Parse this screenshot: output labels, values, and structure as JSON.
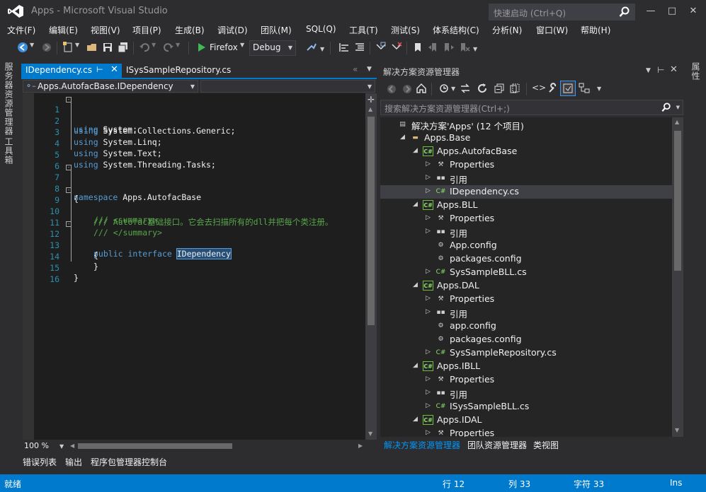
{
  "window": {
    "title": "Apps - Microsoft Visual Studio",
    "quick_launch_placeholder": "快速启动 (Ctrl+Q)",
    "controls": [
      "minimize",
      "maximize",
      "close"
    ]
  },
  "menu": [
    "文件(F)",
    "编辑(E)",
    "视图(V)",
    "项目(P)",
    "生成(B)",
    "调试(D)",
    "团队(M)",
    "SQL(Q)",
    "工具(T)",
    "测试(S)",
    "体系结构(C)",
    "分析(N)",
    "窗口(W)",
    "帮助(H)"
  ],
  "toolbar": {
    "browser": "Firefox",
    "configuration": "Debug"
  },
  "left_side_tabs": [
    "服务器资源管理器",
    "工具箱"
  ],
  "right_side_tabs": [
    "属性"
  ],
  "editor": {
    "tabs": [
      {
        "label": "IDependency.cs",
        "active": true
      },
      {
        "label": "ISysSampleRepository.cs",
        "active": false
      }
    ],
    "nav_left": "Apps.AutofacBase.IDependency",
    "nav_right": "",
    "zoom": "100 %",
    "lines": [
      {
        "n": "1",
        "text": "using System;"
      },
      {
        "n": "2",
        "text": "using System.Collections.Generic;"
      },
      {
        "n": "3",
        "text": "using System.Linq;"
      },
      {
        "n": "4",
        "text": "using System.Text;"
      },
      {
        "n": "5",
        "text": "using System.Threading.Tasks;"
      },
      {
        "n": "6",
        "text": ""
      },
      {
        "n": "7",
        "text": "namespace Apps.AutofacBase"
      },
      {
        "n": "8",
        "text": "{"
      },
      {
        "n": "9",
        "text": "/// <summary>"
      },
      {
        "n": "10",
        "text": "/// Autofac基础接口。它会去扫描所有的dll并把每个类注册。"
      },
      {
        "n": "11",
        "text": "/// </summary>"
      },
      {
        "n": "12",
        "text": "public interface IDependency"
      },
      {
        "n": "13",
        "text": "{"
      },
      {
        "n": "14",
        "text": "}"
      },
      {
        "n": "15",
        "text": "}"
      },
      {
        "n": "16",
        "text": ""
      }
    ]
  },
  "solution_explorer": {
    "title": "解决方案资源管理器",
    "search_placeholder": "搜索解决方案资源管理器(Ctrl+;)",
    "items": [
      {
        "label": "解决方案'Apps' (12 个项目)",
        "icon": "solution-icon",
        "level": 0,
        "twisty": ""
      },
      {
        "label": "Apps.Base",
        "icon": "folder-icon",
        "level": 1,
        "twisty": "open"
      },
      {
        "label": "Apps.AutofacBase",
        "icon": "csproj-icon",
        "level": 2,
        "twisty": "open"
      },
      {
        "label": "Properties",
        "icon": "wrench-icon",
        "level": 3,
        "twisty": "closed"
      },
      {
        "label": "引用",
        "icon": "references-icon",
        "level": 3,
        "twisty": "closed"
      },
      {
        "label": "IDependency.cs",
        "icon": "csfile-icon",
        "level": 3,
        "twisty": "closed",
        "selected": true
      },
      {
        "label": "Apps.BLL",
        "icon": "csproj-icon",
        "level": 2,
        "twisty": "open"
      },
      {
        "label": "Properties",
        "icon": "wrench-icon",
        "level": 3,
        "twisty": "closed"
      },
      {
        "label": "引用",
        "icon": "references-icon",
        "level": 3,
        "twisty": "closed"
      },
      {
        "label": "App.config",
        "icon": "config-icon",
        "level": 3,
        "twisty": ""
      },
      {
        "label": "packages.config",
        "icon": "config-icon",
        "level": 3,
        "twisty": ""
      },
      {
        "label": "SysSampleBLL.cs",
        "icon": "csfile-icon",
        "level": 3,
        "twisty": "closed"
      },
      {
        "label": "Apps.DAL",
        "icon": "csproj-icon",
        "level": 2,
        "twisty": "open"
      },
      {
        "label": "Properties",
        "icon": "wrench-icon",
        "level": 3,
        "twisty": "closed"
      },
      {
        "label": "引用",
        "icon": "references-icon",
        "level": 3,
        "twisty": "closed"
      },
      {
        "label": "app.config",
        "icon": "config-icon",
        "level": 3,
        "twisty": ""
      },
      {
        "label": "packages.config",
        "icon": "config-icon",
        "level": 3,
        "twisty": ""
      },
      {
        "label": "SysSampleRepository.cs",
        "icon": "csfile-icon",
        "level": 3,
        "twisty": "closed"
      },
      {
        "label": "Apps.IBLL",
        "icon": "csproj-icon",
        "level": 2,
        "twisty": "open"
      },
      {
        "label": "Properties",
        "icon": "wrench-icon",
        "level": 3,
        "twisty": "closed"
      },
      {
        "label": "引用",
        "icon": "references-icon",
        "level": 3,
        "twisty": "closed"
      },
      {
        "label": "ISysSampleBLL.cs",
        "icon": "csfile-icon",
        "level": 3,
        "twisty": "closed"
      },
      {
        "label": "Apps.IDAL",
        "icon": "csproj-icon",
        "level": 2,
        "twisty": "open"
      },
      {
        "label": "Properties",
        "icon": "wrench-icon",
        "level": 3,
        "twisty": "closed"
      }
    ],
    "bottom_tabs": [
      "解决方案资源管理器",
      "团队资源管理器",
      "类视图"
    ]
  },
  "bottom_panel_tabs": [
    "错误列表",
    "输出",
    "程序包管理器控制台"
  ],
  "status": {
    "ready": "就绪",
    "line": "行 12",
    "col": "列 33",
    "char": "字符 33",
    "mode": "Ins"
  },
  "colors": {
    "accent": "#007acc",
    "background": "#2d2d30",
    "editor_bg": "#1e1e1e",
    "keyword": "#569cd6",
    "comment": "#57a64a",
    "line_number": "#2b91af"
  }
}
